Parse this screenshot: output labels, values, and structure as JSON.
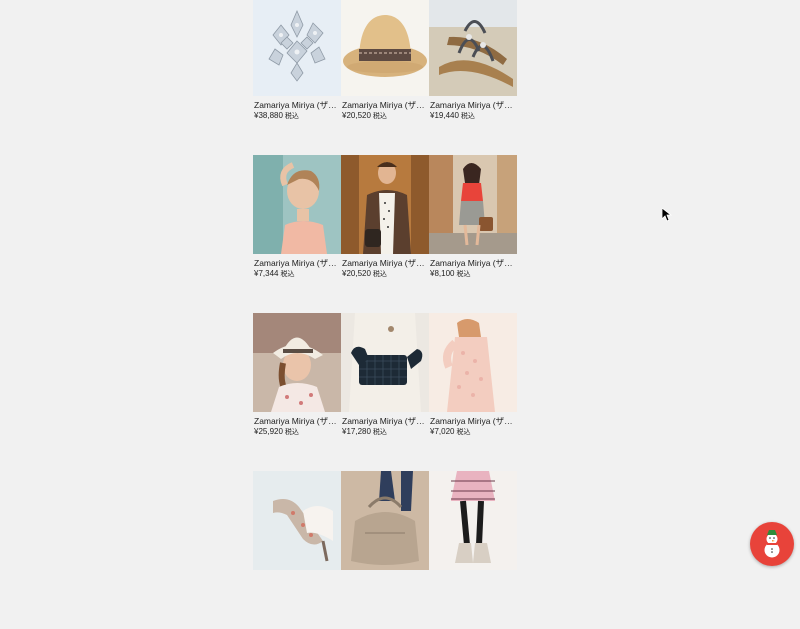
{
  "products": [
    {
      "name": "Zamariya Miriya (ザマリーヤ・ミリヤ)",
      "price": "¥38,880",
      "tax": "税込",
      "image": "crystal-brooch"
    },
    {
      "name": "Zamariya Miriya (ザマリーヤ・ミリヤ)",
      "price": "¥20,520",
      "tax": "税込",
      "image": "straw-hat"
    },
    {
      "name": "Zamariya Miriya (ザマリーヤ・ミリヤ)",
      "price": "¥19,440",
      "tax": "税込",
      "image": "sandals"
    },
    {
      "name": "Zamariya Miriya (ザマリーヤ・ミリヤ)",
      "price": "¥7,344",
      "tax": "税込",
      "image": "woman-portrait"
    },
    {
      "name": "Zamariya Miriya (ザマリーヤ・ミリヤ)",
      "price": "¥20,520",
      "tax": "税込",
      "image": "man-with-bag"
    },
    {
      "name": "Zamariya Miriya (ザマリーヤ・ミリヤ)",
      "price": "¥8,100",
      "tax": "税込",
      "image": "woman-street"
    },
    {
      "name": "Zamariya Miriya (ザマリーヤ・ミリヤ)",
      "price": "¥25,920",
      "tax": "税込",
      "image": "woman-hat"
    },
    {
      "name": "Zamariya Miriya (ザマリーヤ・ミリヤ)",
      "price": "¥17,280",
      "tax": "税込",
      "image": "quilted-clutch"
    },
    {
      "name": "Zamariya Miriya (ザマリーヤ・ミリヤ)",
      "price": "¥7,020",
      "tax": "税込",
      "image": "pink-dress"
    },
    {
      "name": "",
      "price": "",
      "tax": "",
      "image": "heels"
    },
    {
      "name": "",
      "price": "",
      "tax": "",
      "image": "handbag"
    },
    {
      "name": "",
      "price": "",
      "tax": "",
      "image": "skirt-boots"
    }
  ],
  "chat_button": {
    "icon": "snowman-icon",
    "color": "#e8433a"
  }
}
